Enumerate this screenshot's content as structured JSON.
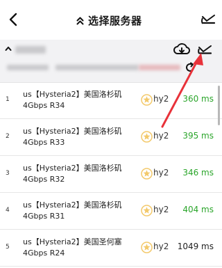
{
  "header": {
    "title": "选择服务器"
  },
  "group": {
    "name": ""
  },
  "servers": [
    {
      "index": "1",
      "name_line1": "us【Hysteria2】美国洛杉矶",
      "name_line2": "4Gbps R34",
      "type": "hy2",
      "latency": "360 ms",
      "latency_color": "#2aa52a"
    },
    {
      "index": "2",
      "name_line1": "us【Hysteria2】美国洛杉矶",
      "name_line2": "4Gbps R33",
      "type": "hy2",
      "latency": "395 ms",
      "latency_color": "#2aa52a"
    },
    {
      "index": "3",
      "name_line1": "us【Hysteria2】美国洛杉矶",
      "name_line2": "4Gbps R32",
      "type": "hy2",
      "latency": "346 ms",
      "latency_color": "#2aa52a"
    },
    {
      "index": "4",
      "name_line1": "us【Hysteria2】美国洛杉矶",
      "name_line2": "4Gbps R31",
      "type": "hy2",
      "latency": "404 ms",
      "latency_color": "#2aa52a"
    },
    {
      "index": "5",
      "name_line1": "us【Hysteria2】美国圣何塞",
      "name_line2": "4Gbps R24",
      "type": "hy2",
      "latency": "1049 ms",
      "latency_color": "#222222"
    }
  ],
  "icons": {
    "back": "chevron-left-icon",
    "collapse": "double-chevron-up-icon",
    "speedtest": "speedometer-icon",
    "cloud": "cloud-download-icon",
    "refresh": "refresh-icon",
    "star": "star-badge-icon"
  },
  "colors": {
    "accent_green": "#2aa52a",
    "annotation_red": "#e8323a",
    "star_yellow": "#f3c96b"
  }
}
